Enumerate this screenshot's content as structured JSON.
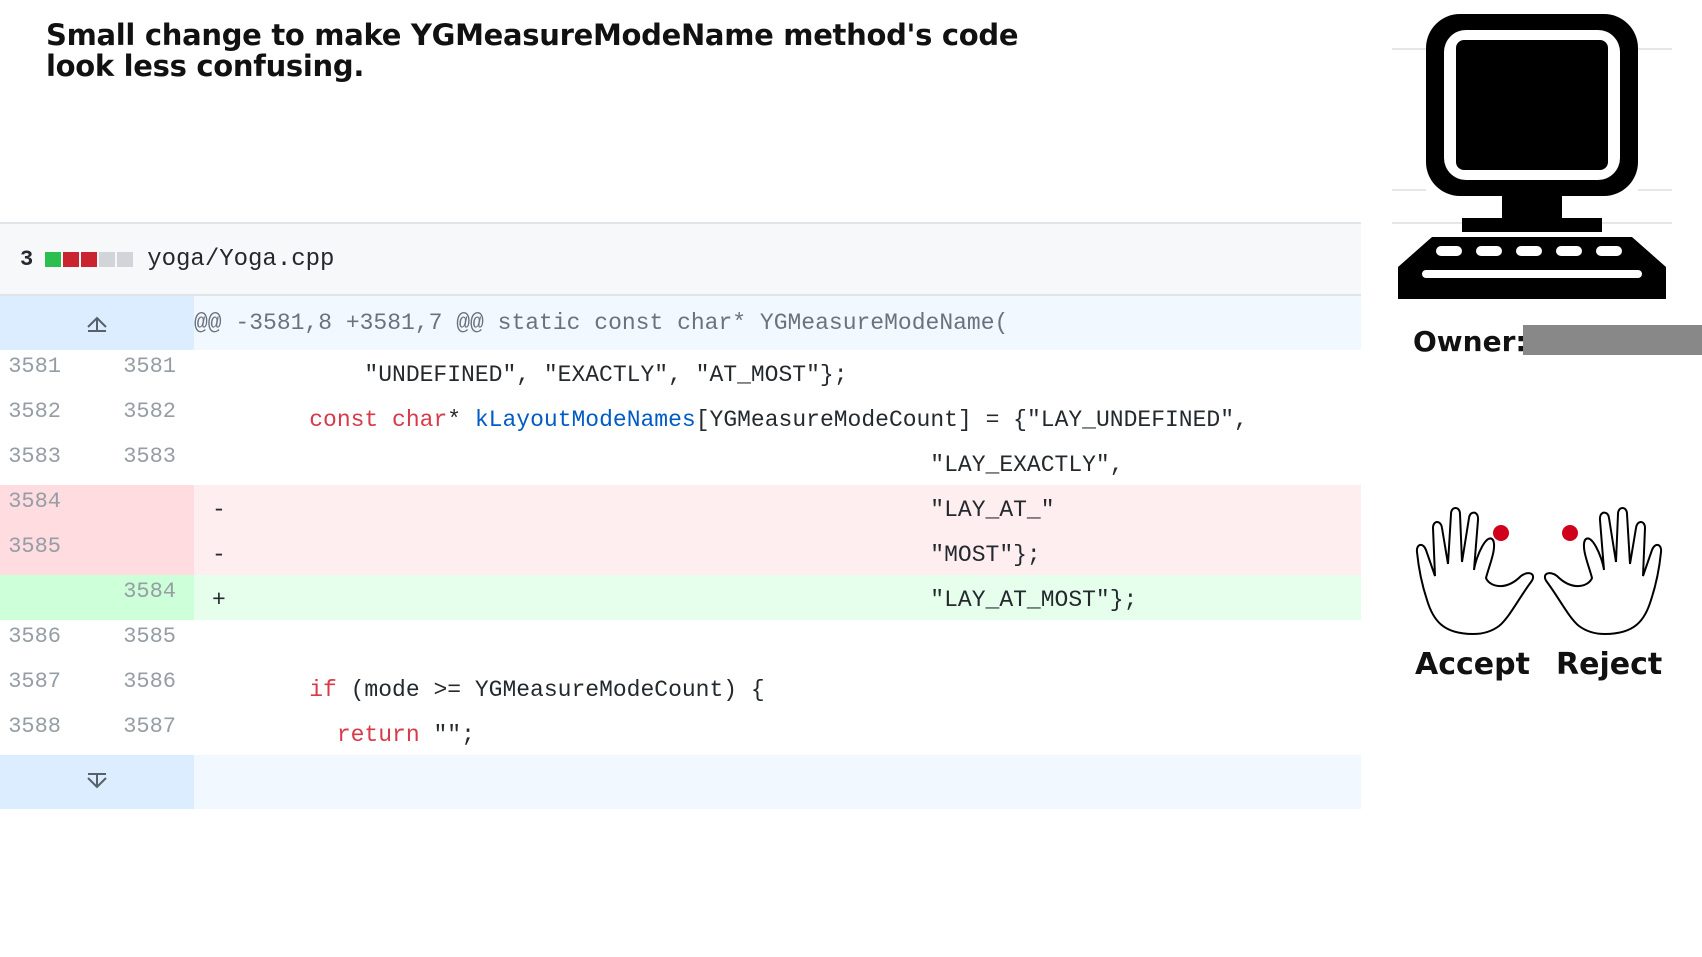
{
  "title": "Small change to make YGMeasureModeName method's code look less confusing.",
  "diff": {
    "change_count": "3",
    "stat_blocks": [
      "#2cbe4e",
      "#cb2431",
      "#cb2431",
      "#d1d5da",
      "#d1d5da"
    ],
    "file_name": "yoga/Yoga.cpp",
    "hunk_header": "@@ -3581,8 +3581,7 @@ static const char* YGMeasureModeName(",
    "lines": [
      {
        "type": "ctx",
        "old": "3581",
        "new": "3581",
        "segments": [
          {
            "text": "        \"UNDEFINED\", \"EXACTLY\", \"AT_MOST\"};",
            "cls": ""
          }
        ]
      },
      {
        "type": "ctx",
        "old": "3582",
        "new": "3582",
        "segments": [
          {
            "text": "    ",
            "cls": ""
          },
          {
            "text": "const",
            "cls": "kw"
          },
          {
            "text": " ",
            "cls": ""
          },
          {
            "text": "char",
            "cls": "kw"
          },
          {
            "text": "* ",
            "cls": ""
          },
          {
            "text": "kLayoutModeNames",
            "cls": "fn"
          },
          {
            "text": "[YGMeasureModeCount] = {\"LAY_UNDEFINED\",",
            "cls": ""
          }
        ]
      },
      {
        "type": "ctx",
        "old": "3583",
        "new": "3583",
        "segments": [
          {
            "text": "                                                 \"LAY_EXACTLY\",",
            "cls": ""
          }
        ]
      },
      {
        "type": "del",
        "old": "3584",
        "new": "",
        "sign": "-",
        "segments": [
          {
            "text": "                                                 \"LAY_AT_\"",
            "cls": ""
          }
        ]
      },
      {
        "type": "del",
        "old": "3585",
        "new": "",
        "sign": "-",
        "segments": [
          {
            "text": "                                                 \"MOST\"};",
            "cls": ""
          }
        ]
      },
      {
        "type": "add",
        "old": "",
        "new": "3584",
        "sign": "+",
        "segments": [
          {
            "text": "                                                 \"LAY_AT_MOST\"};",
            "cls": ""
          }
        ]
      },
      {
        "type": "ctx",
        "old": "3586",
        "new": "3585",
        "segments": [
          {
            "text": "",
            "cls": ""
          }
        ]
      },
      {
        "type": "ctx",
        "old": "3587",
        "new": "3586",
        "segments": [
          {
            "text": "    ",
            "cls": ""
          },
          {
            "text": "if",
            "cls": "kw"
          },
          {
            "text": " (mode >= YGMeasureModeCount) {",
            "cls": ""
          }
        ]
      },
      {
        "type": "ctx",
        "old": "3588",
        "new": "3587",
        "segments": [
          {
            "text": "      ",
            "cls": ""
          },
          {
            "text": "return",
            "cls": "kw"
          },
          {
            "text": " \"\";",
            "cls": ""
          }
        ]
      }
    ]
  },
  "owner": {
    "label": "Owner:",
    "bar_color": "#888888"
  },
  "actions": {
    "accept_label": "Accept",
    "reject_label": "Reject",
    "dot_color": "#d0021b"
  }
}
